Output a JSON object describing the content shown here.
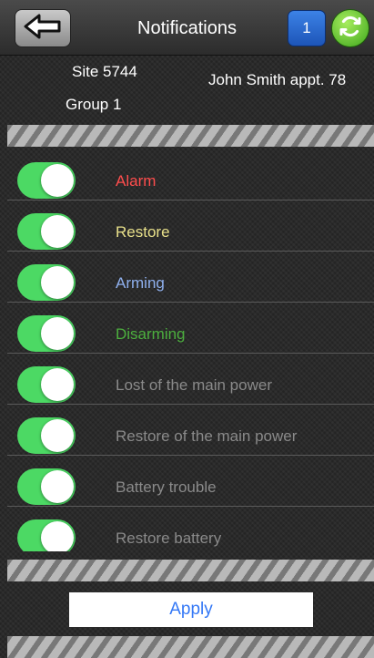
{
  "header": {
    "title": "Notifications",
    "badge_count": "1",
    "back_icon": "arrow-left-icon",
    "refresh_icon": "refresh-icon"
  },
  "site": {
    "name": "Site 5744",
    "group": "Group 1",
    "client": "John Smith appt. 78"
  },
  "notifications": [
    {
      "label": "Alarm",
      "enabled": true,
      "color": "#ff4d4d"
    },
    {
      "label": "Restore",
      "enabled": true,
      "color": "#e8e08a"
    },
    {
      "label": "Arming",
      "enabled": true,
      "color": "#8fb0ee"
    },
    {
      "label": "Disarming",
      "enabled": true,
      "color": "#4caf3e"
    },
    {
      "label": "Lost of the main power",
      "enabled": true,
      "color": "#8a8a8a"
    },
    {
      "label": "Restore of the main power",
      "enabled": true,
      "color": "#8a8a8a"
    },
    {
      "label": "Battery trouble",
      "enabled": true,
      "color": "#8a8a8a"
    },
    {
      "label": "Restore battery",
      "enabled": true,
      "color": "#8a8a8a"
    }
  ],
  "footer": {
    "apply_label": "Apply"
  },
  "colors": {
    "toggle_on": "#4cd964",
    "badge": "#2a6fd6",
    "refresh": "#5cc630",
    "apply_text": "#3478f6"
  }
}
